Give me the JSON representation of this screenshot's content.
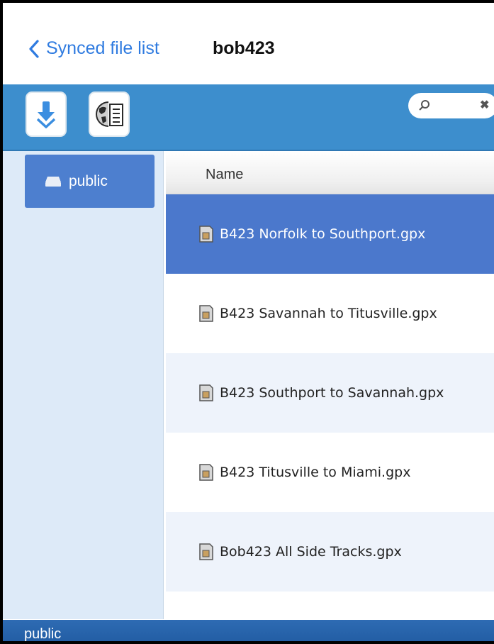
{
  "nav": {
    "back_label": "Synced file list",
    "title": "bob423"
  },
  "toolbar": {
    "search": {
      "placeholder": ""
    }
  },
  "sidebar": {
    "items": [
      {
        "label": "public"
      }
    ]
  },
  "list": {
    "header": "Name",
    "rows": [
      {
        "name": "B423 Norfolk to Southport.gpx",
        "selected": true
      },
      {
        "name": "B423 Savannah to Titusville.gpx"
      },
      {
        "name": "B423 Southport to Savannah.gpx"
      },
      {
        "name": "B423 Titusville to Miami.gpx"
      },
      {
        "name": "Bob423 All Side Tracks.gpx"
      }
    ]
  },
  "status": {
    "text": "public"
  },
  "colors": {
    "accent": "#2f7be0",
    "toolbar": "#3d8ecd",
    "selected_row": "#4b78cc",
    "sidebar": "#ddeaf8",
    "statusbar": "#1f5aa0"
  }
}
